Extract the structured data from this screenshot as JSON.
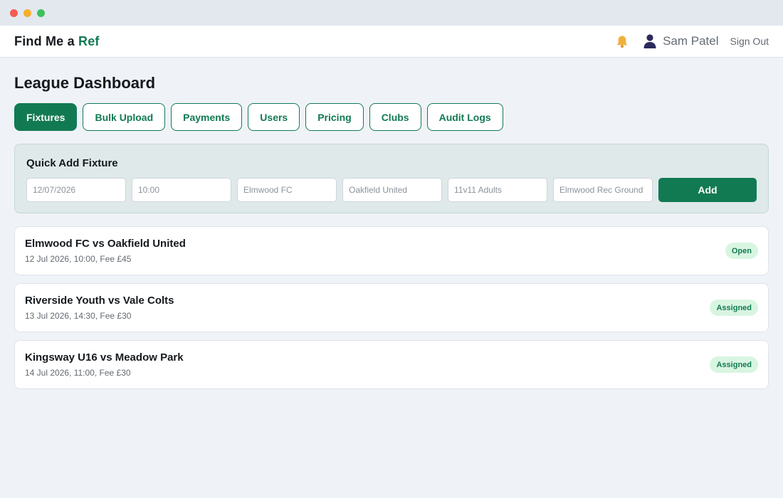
{
  "window": {
    "controls": [
      "close",
      "minimize",
      "maximize"
    ]
  },
  "header": {
    "brand_prefix": "Find Me a ",
    "brand_accent": "Ref",
    "notification_icon": "bell-icon",
    "user_icon": "person-icon",
    "user_name": "Sam Patel",
    "sign_out": "Sign Out"
  },
  "page": {
    "title": "League Dashboard"
  },
  "tabs": [
    {
      "label": "Fixtures",
      "active": true
    },
    {
      "label": "Bulk Upload",
      "active": false
    },
    {
      "label": "Payments",
      "active": false
    },
    {
      "label": "Users",
      "active": false
    },
    {
      "label": "Pricing",
      "active": false
    },
    {
      "label": "Clubs",
      "active": false
    },
    {
      "label": "Audit Logs",
      "active": false
    }
  ],
  "quick_add": {
    "title": "Quick Add Fixture",
    "date_placeholder": "12/07/2026",
    "time_placeholder": "10:00",
    "home_placeholder": "Elmwood FC",
    "away_placeholder": "Oakfield United",
    "format_placeholder": "11v11 Adults",
    "venue_placeholder": "Elmwood Rec Ground",
    "add_label": "Add"
  },
  "fixtures": [
    {
      "title": "Elmwood FC vs Oakfield United",
      "meta": "12 Jul 2026, 10:00, Fee £45",
      "status": "Open"
    },
    {
      "title": "Riverside Youth vs Vale Colts",
      "meta": "13 Jul 2026, 14:30, Fee £30",
      "status": "Assigned"
    },
    {
      "title": "Kingsway U16 vs Meadow Park",
      "meta": "14 Jul 2026, 11:00, Fee £30",
      "status": "Assigned"
    }
  ],
  "colors": {
    "accent": "#127a52",
    "badge_bg": "#d8f5e2",
    "page_bg": "#eff3f8",
    "quick_add_bg": "#dfe9ea",
    "bell": "#f0b13c",
    "user_icon": "#2b2a5c"
  }
}
